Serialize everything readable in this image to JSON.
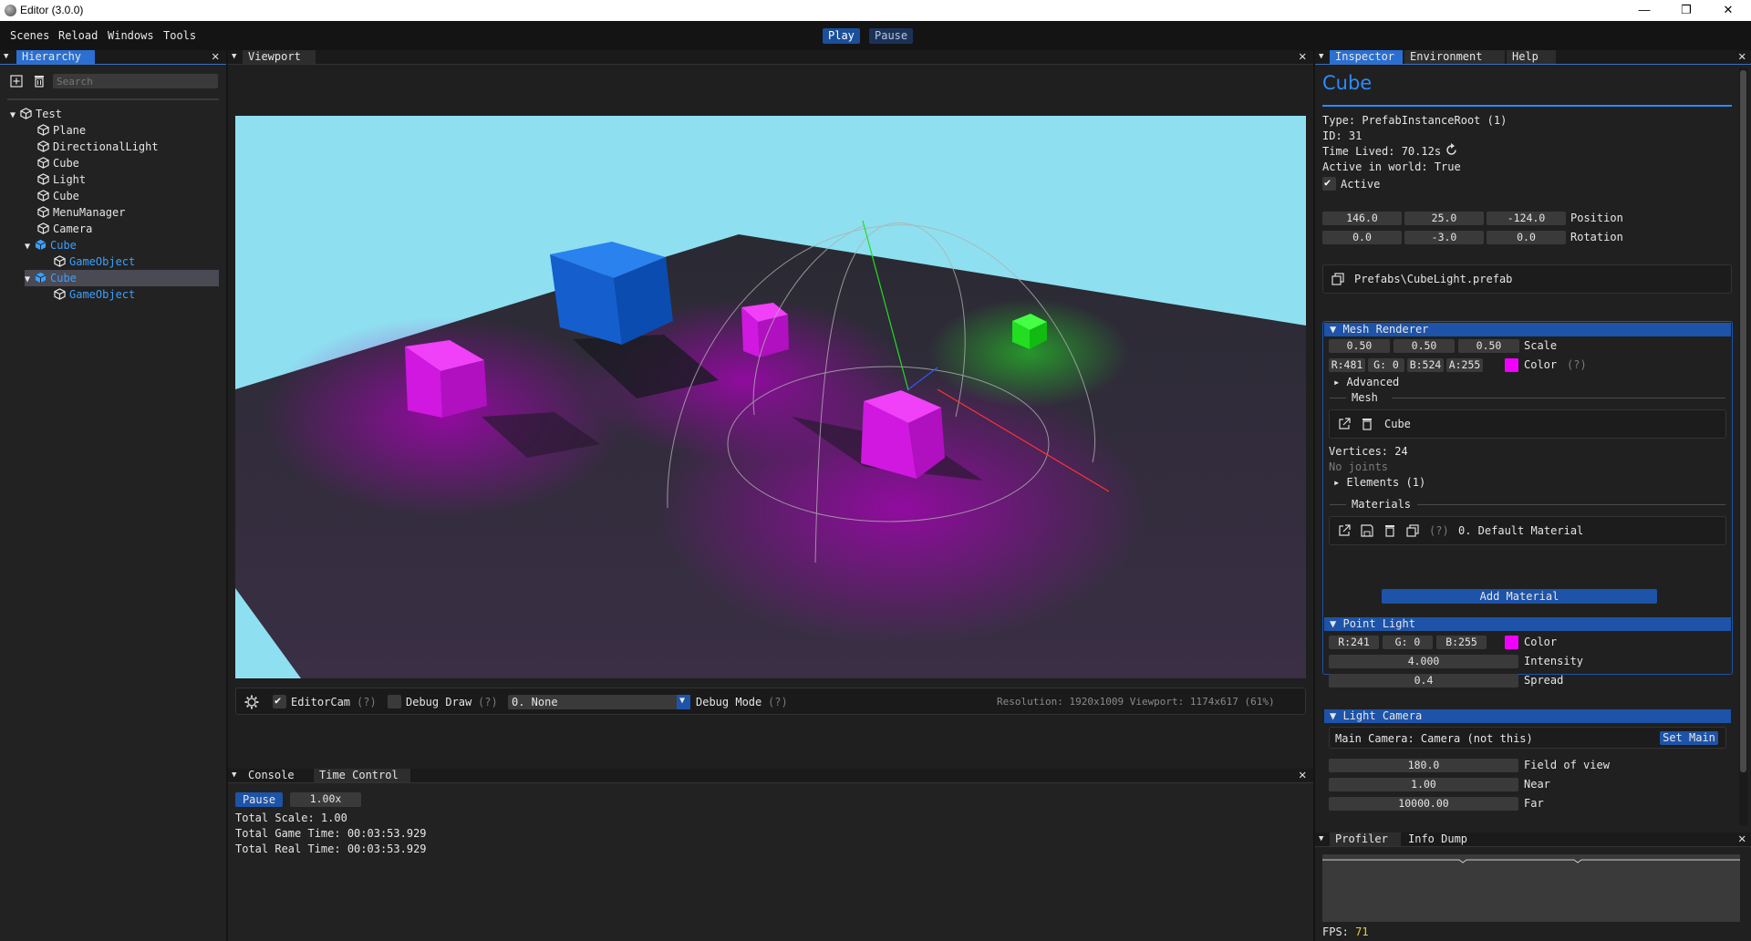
{
  "window": {
    "title": "Editor (3.0.0)",
    "controls": [
      "—",
      "❐",
      "✕"
    ]
  },
  "menubar": {
    "items": [
      "Scenes",
      "Reload",
      "Windows",
      "Tools"
    ],
    "play_label": "Play",
    "pause_label": "Pause"
  },
  "hierarchy": {
    "tab_label": "Hierarchy",
    "search_placeholder": "Search",
    "rows": [
      {
        "label": "Test"
      },
      {
        "label": "Plane"
      },
      {
        "label": "DirectionalLight"
      },
      {
        "label": "Cube"
      },
      {
        "label": "Light"
      },
      {
        "label": "Cube"
      },
      {
        "label": "MenuManager"
      },
      {
        "label": "Camera"
      },
      {
        "label": "Cube"
      },
      {
        "label": "GameObject"
      },
      {
        "label": "Cube"
      },
      {
        "label": "GameObject"
      }
    ]
  },
  "viewport": {
    "tab_label": "Viewport",
    "editor_cam_label": "EditorCam",
    "debug_draw_label": "Debug Draw",
    "help_mark": "(?)",
    "debug_mode_value": "0. None",
    "debug_mode_label": "Debug Mode",
    "resolution_text": "Resolution: 1920x1009 Viewport: 1174x617 (61%)"
  },
  "console": {
    "tabs": [
      "Console",
      "Time Control"
    ],
    "pause_label": "Pause",
    "speed_value": "1.00x",
    "lines": [
      "Total Scale: 1.00",
      "Total Game Time: 00:03:53.929",
      "Total Real Time: 00:03:53.929"
    ]
  },
  "inspector": {
    "tabs": [
      "Inspector",
      "Environment",
      "Help"
    ],
    "object_name": "Cube",
    "type_line": "Type: PrefabInstanceRoot (1)",
    "id_line": "ID: 31",
    "time_lived_line": "Time Lived: 70.12s",
    "active_world_line": "Active in world: True",
    "active_label": "Active",
    "position": [
      "146.0",
      "25.0",
      "-124.0"
    ],
    "position_label": "Position",
    "rotation": [
      "0.0",
      "-3.0",
      "0.0"
    ],
    "rotation_label": "Rotation",
    "prefab_path": "Prefabs\\CubeLight.prefab",
    "mesh_renderer": {
      "header": "Mesh Renderer",
      "scale": [
        "0.50",
        "0.50",
        "0.50"
      ],
      "scale_label": "Scale",
      "color_fields": [
        "R:481",
        "G:  0",
        "B:524",
        "A:255"
      ],
      "color_label": "Color",
      "color_hex": "#f100ff",
      "help_mark": "(?)",
      "advanced_label": "Advanced",
      "mesh_section": "Mesh",
      "mesh_name": "Cube",
      "vertices_line": "Vertices: 24",
      "joints_line": "No joints",
      "elements_label": "Elements (1)",
      "materials_section": "Materials",
      "material_help": "(?)",
      "material_name": "0. Default Material",
      "add_material_label": "Add Material"
    },
    "point_light": {
      "header": "Point Light",
      "color_fields": [
        "R:241",
        "G:  0",
        "B:255"
      ],
      "color_label": "Color",
      "color_hex": "#f100ff",
      "intensity_value": "4.000",
      "intensity_label": "Intensity",
      "spread_value": "0.4",
      "spread_label": "Spread"
    },
    "light_camera": {
      "header": "Light Camera",
      "main_camera_line": "Main Camera: Camera (not this)",
      "set_main_label": "Set Main",
      "fov_value": "180.0",
      "fov_label": "Field of view",
      "near_value": "1.00",
      "near_label": "Near",
      "far_value": "10000.00",
      "far_label": "Far"
    }
  },
  "profiler": {
    "tabs": [
      "Profiler",
      "Info Dump"
    ],
    "fps_label": "FPS:",
    "fps_value": "71"
  },
  "colors": {
    "accent": "#2a6fd1",
    "section": "#1d53a8",
    "sky": "#8ee0f0",
    "cube_magenta": "#e000e8",
    "cube_blue": "#1c6fd9",
    "cube_green": "#22dd22"
  }
}
